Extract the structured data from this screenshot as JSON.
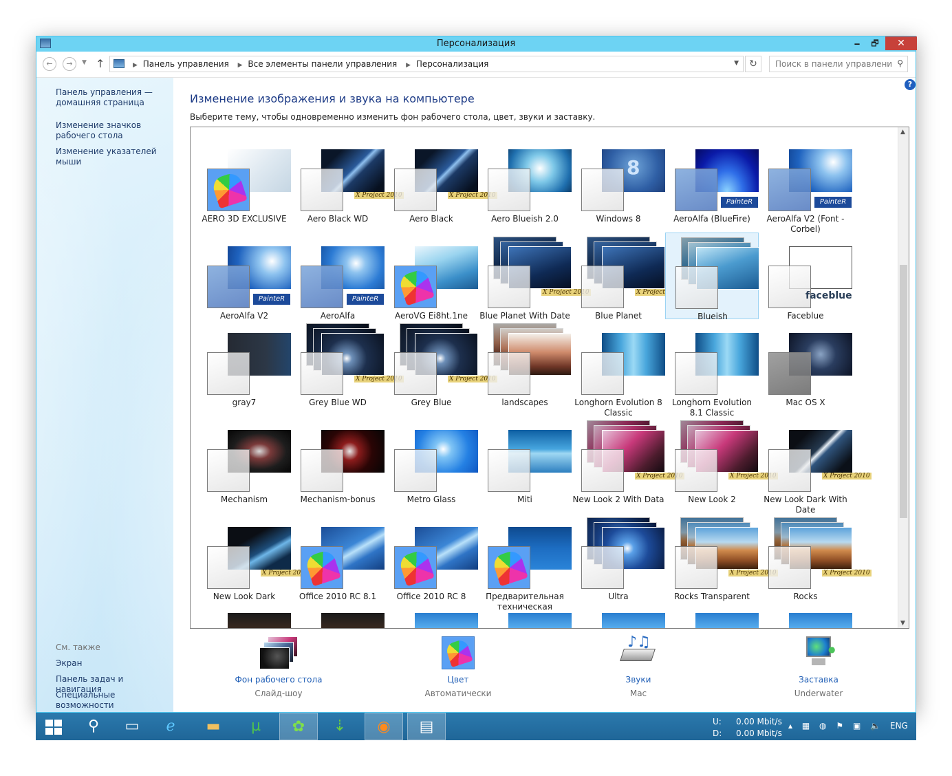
{
  "window": {
    "title": "Персонализация",
    "minimize": "🗕",
    "maximize": "🗗",
    "close": "✕"
  },
  "address": {
    "crumbs": [
      "Панель управления",
      "Все элементы панели управления",
      "Персонализация"
    ],
    "search_placeholder": "Поиск в панели управления"
  },
  "sidebar": {
    "links": [
      "Панель управления — домашняя страница",
      "Изменение значков рабочего стола",
      "Изменение указателей мыши"
    ],
    "see_also": "См. также",
    "see_also_links": [
      "Экран",
      "Панель задач и навигация",
      "Специальные возможности"
    ]
  },
  "main": {
    "heading": "Изменение изображения и звука на компьютере",
    "subtitle": "Выберите тему, чтобы одновременно изменить фон рабочего стола, цвет, звуки и заставку.",
    "help": "?"
  },
  "themes": [
    {
      "label": "AERO 3D EXCLUSIVE",
      "bg": "linear-gradient(135deg,#ffffff 0%,#dfe9f1 50%,#c5d6e3 100%)",
      "swatch": "rainbow",
      "badge": "",
      "selected": false,
      "stack": false
    },
    {
      "label": "Aero Black WD",
      "bg": "linear-gradient(135deg,#0a1628 20%,#2a5a9a 48%,#8fc0ef 52%,#1c3a66 60%,#07101f 90%)",
      "swatch": "light",
      "badge": "X Project 2010",
      "selected": false,
      "stack": false
    },
    {
      "label": "Aero Black",
      "bg": "linear-gradient(135deg,#0a1628 20%,#2a5a9a 48%,#8fc0ef 52%,#1c3a66 60%,#07101f 90%)",
      "swatch": "light",
      "badge": "X Project 2010",
      "selected": false,
      "stack": false
    },
    {
      "label": "Aero Blueish 2.0",
      "bg": "radial-gradient(circle at 50% 45%,#ffffff 0%,#7ec8e8 35%,#1f6fae 75%,#0c3d6b 100%)",
      "swatch": "light",
      "badge": "",
      "selected": false,
      "stack": false
    },
    {
      "label": "Windows 8",
      "bg": "radial-gradient(circle at 50% 40%,#6ea3d8 0%,#2f5fa5 60%,#1d3e7a 100%)",
      "swatch": "light",
      "badge": "",
      "selected": false,
      "stack": false,
      "mark": "8"
    },
    {
      "label": "AeroAlfa (BlueFire)",
      "bg": "radial-gradient(ellipse at 50% 100%,#8fd6ff 0%,#2f6ee8 35%,#0a1aa8 70%,#050a60 100%)",
      "swatch": "blue",
      "badge": "PainteR",
      "selected": false,
      "stack": false
    },
    {
      "label": "AeroAlfa V2 (Font - Corbel)",
      "bg": "radial-gradient(circle at 70% 30%,#ffffff 0%,#8ec3ef 25%,#1f63bf 65%,#0d3a86 100%)",
      "swatch": "blue",
      "badge": "PainteR",
      "selected": false,
      "stack": false
    },
    {
      "label": "AeroAlfa V2",
      "bg": "radial-gradient(circle at 70% 35%,#ffffff 0%,#8ec3ef 25%,#1f63bf 65%,#0d3a86 100%)",
      "swatch": "blue",
      "badge": "PainteR",
      "selected": false,
      "stack": false
    },
    {
      "label": "AeroAlfa",
      "bg": "radial-gradient(circle at 55% 40%,#ffffff 0%,#8ec3ef 22%,#2c7bd4 60%,#114c9a 100%)",
      "swatch": "blue",
      "badge": "PainteR",
      "selected": false,
      "stack": false
    },
    {
      "label": "AeroVG Ei8ht.1ne",
      "bg": "linear-gradient(160deg,#e9f6fd 0%,#9ad4ef 35%,#3b8fc9 70%,#1d5c93 100%)",
      "swatch": "rainbow",
      "badge": "",
      "selected": false,
      "stack": false
    },
    {
      "label": "Blue Planet With Date",
      "bg": "linear-gradient(160deg,#3e74b8 0%,#0f2a55 60%,#060f22 100%)",
      "swatch": "light",
      "badge": "X Project 2010",
      "selected": false,
      "stack": true
    },
    {
      "label": "Blue Planet",
      "bg": "linear-gradient(160deg,#3e74b8 0%,#0f2a55 60%,#060f22 100%)",
      "swatch": "light",
      "badge": "X Project 2010",
      "selected": false,
      "stack": true
    },
    {
      "label": "Blueish",
      "bg": "linear-gradient(160deg,#bfe4f5 0%,#4b9bcf 45%,#1b5b92 100%)",
      "swatch": "light",
      "badge": "",
      "selected": true,
      "stack": true
    },
    {
      "label": "Faceblue",
      "bg": "linear-gradient(#ffffff,#ffffff)",
      "swatch": "light",
      "badge": "",
      "selected": false,
      "stack": false,
      "mark": "faceblue"
    },
    {
      "label": "gray7",
      "bg": "linear-gradient(90deg,#252a33 0%,#2c3746 60%,#23456b 100%)",
      "swatch": "light",
      "badge": "",
      "selected": false,
      "stack": false
    },
    {
      "label": "Grey Blue WD",
      "bg": "radial-gradient(circle at 40% 60%,#ffffff 0%,#6d8fb8 12%,#1d2f4d 45%,#0a1220 100%)",
      "swatch": "light",
      "badge": "X Project 2010",
      "selected": false,
      "stack": true
    },
    {
      "label": "Grey Blue",
      "bg": "radial-gradient(circle at 40% 60%,#ffffff 0%,#6d8fb8 12%,#1d2f4d 45%,#0a1220 100%)",
      "swatch": "light",
      "badge": "X Project 2010",
      "selected": false,
      "stack": true
    },
    {
      "label": "landscapes",
      "bg": "linear-gradient(180deg,#f4f0ea 0%,#cf8b6c 45%,#6e3526 80%,#2d1a12 100%)",
      "swatch": "light",
      "badge": "",
      "selected": false,
      "stack": true
    },
    {
      "label": "Longhorn Evolution 8 Classic",
      "bg": "linear-gradient(90deg,#0f4d86 0%,#48a6dc 30%,#9bd9f5 50%,#48a6dc 70%,#0f4d86 100%)",
      "swatch": "light",
      "badge": "",
      "selected": false,
      "stack": false
    },
    {
      "label": "Longhorn Evolution 8.1 Classic",
      "bg": "linear-gradient(90deg,#0f4d86 0%,#48a6dc 30%,#9bd9f5 50%,#48a6dc 70%,#0f4d86 100%)",
      "swatch": "light",
      "badge": "",
      "selected": false,
      "stack": false
    },
    {
      "label": "Mac OS X",
      "bg": "radial-gradient(circle at 50% 50%,#8aa3c4 0%,#2a3d5f 40%,#0d1426 100%)",
      "swatch": "gray",
      "badge": "",
      "selected": false,
      "stack": false
    },
    {
      "label": "Mechanism",
      "bg": "radial-gradient(ellipse at 50% 50%,#d9d9d9 0%,#7a3a3a 25%,#1d1d1d 60%,#050505 100%)",
      "swatch": "light",
      "badge": "",
      "selected": false,
      "stack": false
    },
    {
      "label": "Mechanism-bonus",
      "bg": "radial-gradient(circle at 45% 50%,#e8e8e8 0%,#8c1c1c 22%,#2a0505 55%,#050505 100%)",
      "swatch": "light",
      "badge": "",
      "selected": false,
      "stack": false
    },
    {
      "label": "Metro Glass",
      "bg": "radial-gradient(circle at 45% 45%,#ffffff 0%,#7fc4f5 20%,#2480e3 60%,#0f57c2 100%)",
      "swatch": "light",
      "badge": "",
      "selected": false,
      "stack": false
    },
    {
      "label": "Miti",
      "bg": "linear-gradient(180deg,#0e5fa3 0%,#47a6df 45%,#9fd8f3 55%,#2d7fc0 100%)",
      "swatch": "light",
      "badge": "",
      "selected": false,
      "stack": false
    },
    {
      "label": "New Look 2 With Data",
      "bg": "linear-gradient(135deg,#e5c2d9 0%,#c8397a 40%,#4c1c2d 75%,#120a10 100%)",
      "swatch": "light",
      "badge": "X Project 2010",
      "selected": false,
      "stack": true
    },
    {
      "label": "New Look 2",
      "bg": "linear-gradient(135deg,#e5c2d9 0%,#c8397a 40%,#4c1c2d 75%,#120a10 100%)",
      "swatch": "light",
      "badge": "X Project 2010",
      "selected": false,
      "stack": true
    },
    {
      "label": "New Look Dark With Date",
      "bg": "linear-gradient(135deg,#0b0e14 20%,#24384e 45%,#e6edf4 50%,#30557e 56%,#0b1018 85%)",
      "swatch": "light",
      "badge": "X Project 2010",
      "selected": false,
      "stack": false
    },
    {
      "label": "New Look Dark",
      "bg": "linear-gradient(150deg,#0b0e14 30%,#1d4d7a 55%,#6eb6e8 62%,#0e2a48 80%)",
      "swatch": "light",
      "badge": "X Project 2010",
      "selected": false,
      "stack": false
    },
    {
      "label": "Office 2010 RC 8.1",
      "bg": "linear-gradient(150deg,#1b4d97 0%,#3b86d6 45%,#b9e1fa 55%,#2f74c6 70%,#123e80 100%)",
      "swatch": "rainbow",
      "badge": "",
      "selected": false,
      "stack": false
    },
    {
      "label": "Office 2010 RC 8",
      "bg": "linear-gradient(150deg,#1b4d97 0%,#3b86d6 45%,#b9e1fa 55%,#2f74c6 70%,#123e80 100%)",
      "swatch": "rainbow",
      "badge": "",
      "selected": false,
      "stack": false
    },
    {
      "label": "Предварительная техническая",
      "bg": "linear-gradient(180deg,#0e4a8f 0%,#1d6dc2 50%,#2a84d8 100%)",
      "swatch": "rainbow",
      "badge": "",
      "selected": false,
      "stack": false
    },
    {
      "label": "Ultra",
      "bg": "radial-gradient(circle at 40% 50%,#ffffff 0%,#5aa0e8 15%,#1d4b9a 50%,#0a1d45 100%)",
      "swatch": "light",
      "badge": "",
      "selected": false,
      "stack": true
    },
    {
      "label": "Rocks Transparent",
      "bg": "linear-gradient(180deg,#5da3da 0%,#b7d9f0 35%,#d08a4c 55%,#8e4d24 80%,#3c210f 100%)",
      "swatch": "light",
      "badge": "X Project 2010",
      "selected": false,
      "stack": true
    },
    {
      "label": "Rocks",
      "bg": "linear-gradient(180deg,#5da3da 0%,#b7d9f0 35%,#d08a4c 55%,#8e4d24 80%,#3c210f 100%)",
      "swatch": "light",
      "badge": "X Project 2010",
      "selected": false,
      "stack": true
    }
  ],
  "bottom": [
    {
      "label": "Фон рабочего стола",
      "sub": "Слайд-шоу",
      "icon": "desktop-background-icon"
    },
    {
      "label": "Цвет",
      "sub": "Автоматически",
      "icon": "color-icon"
    },
    {
      "label": "Звуки",
      "sub": "Mac",
      "icon": "sounds-icon"
    },
    {
      "label": "Заставка",
      "sub": "Underwater",
      "icon": "screensaver-icon"
    }
  ],
  "taskbar": {
    "net_up_label": "U:",
    "net_up": "0.00 Mbit/s",
    "net_down_label": "D:",
    "net_down": "0.00 Mbit/s",
    "language": "ENG"
  },
  "colors": {
    "titlebar": "#6dd3f3",
    "taskbar": "#1f6698",
    "link": "#1e5db5",
    "heading": "#1e3c87"
  }
}
